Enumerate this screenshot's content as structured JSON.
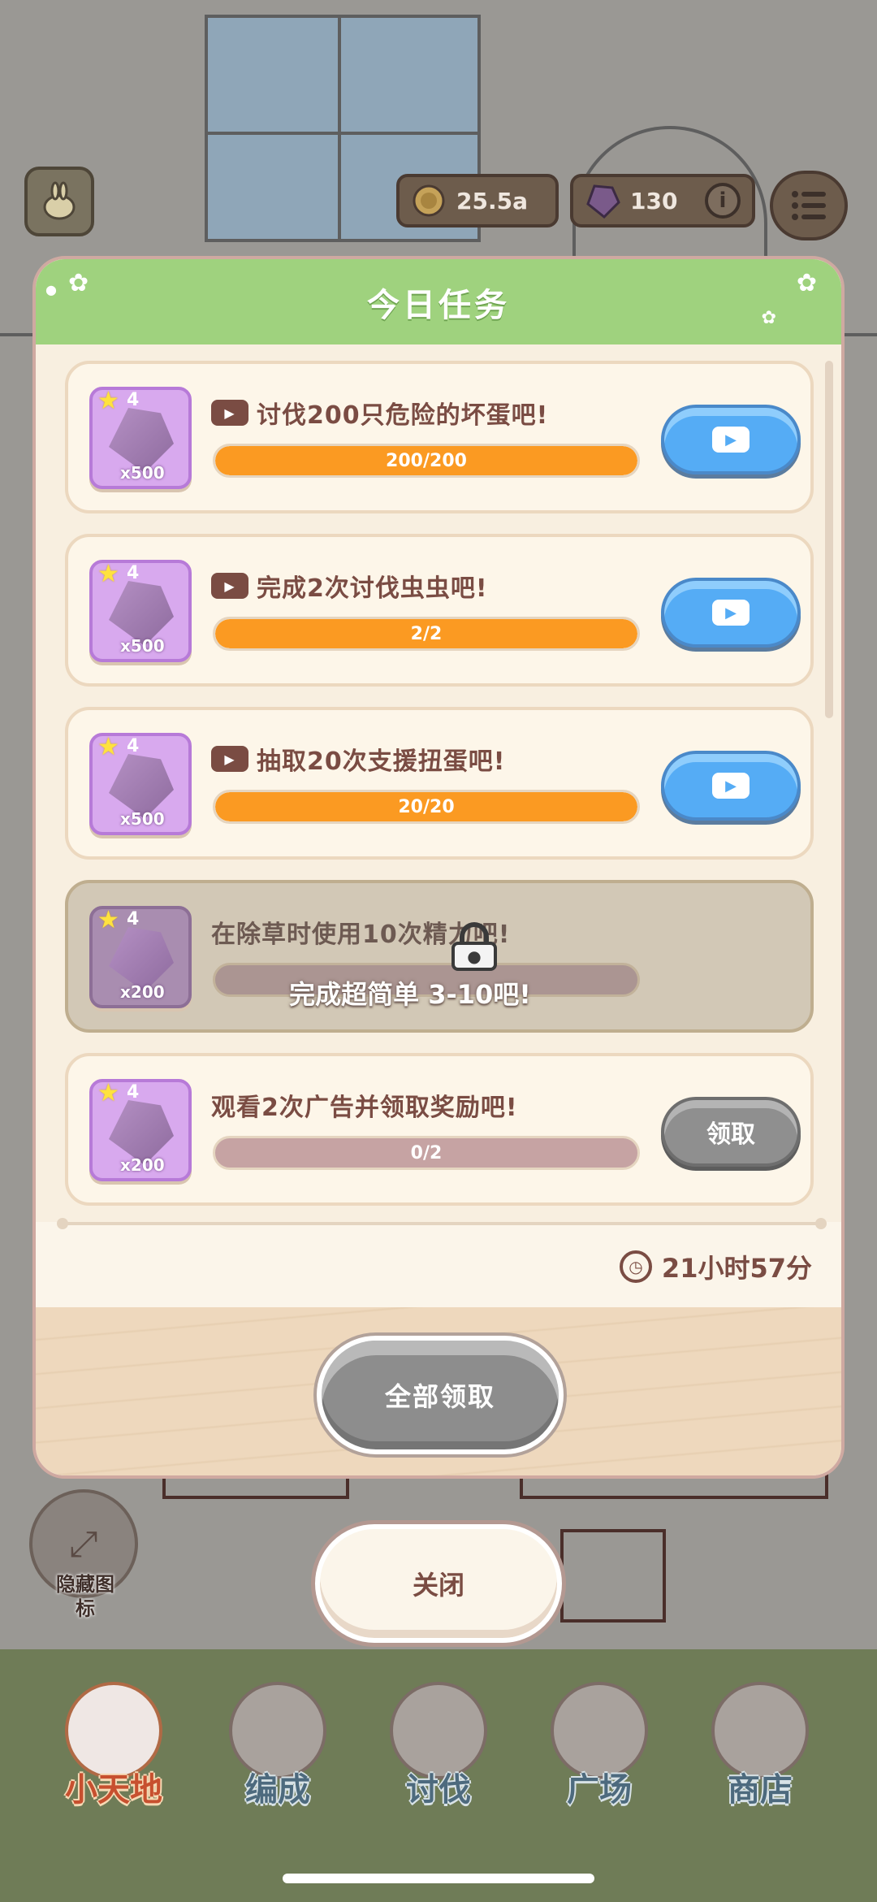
{
  "hud": {
    "coins": "25.5a",
    "gems": "130",
    "info_icon": "i"
  },
  "modal": {
    "title": "今日任务",
    "tasks": [
      {
        "star_level": "4",
        "reward_qty": "x500",
        "text": "讨伐200只危险的坏蛋吧!",
        "progress_label": "200/200",
        "progress": 1.0,
        "action": "video"
      },
      {
        "star_level": "4",
        "reward_qty": "x500",
        "text": "完成2次讨伐虫虫吧!",
        "progress_label": "2/2",
        "progress": 1.0,
        "action": "video"
      },
      {
        "star_level": "4",
        "reward_qty": "x500",
        "text": "抽取20次支援扭蛋吧!",
        "progress_label": "20/20",
        "progress": 1.0,
        "action": "video"
      },
      {
        "star_level": "4",
        "reward_qty": "x200",
        "text": "在除草时使用10次精力吧!",
        "locked": true,
        "lock_text": "完成超简单 3-10吧!"
      },
      {
        "star_level": "4",
        "reward_qty": "x200",
        "text": "观看2次广告并领取奖励吧!",
        "progress_label": "0/2",
        "progress": 0.0,
        "action_label": "领取"
      }
    ],
    "timer": "21小时57分",
    "claim_all_label": "全部领取"
  },
  "close_label": "关闭",
  "hide_icons_label": "隐藏图标",
  "nav": [
    {
      "label": "小天地",
      "active": true
    },
    {
      "label": "编成"
    },
    {
      "label": "讨伐"
    },
    {
      "label": "广场"
    },
    {
      "label": "商店"
    }
  ],
  "colors": {
    "header_green": "#9fd27e",
    "progress_orange": "#fb9a22",
    "video_blue": "#55acf5",
    "text_brown": "#7a4c43"
  }
}
